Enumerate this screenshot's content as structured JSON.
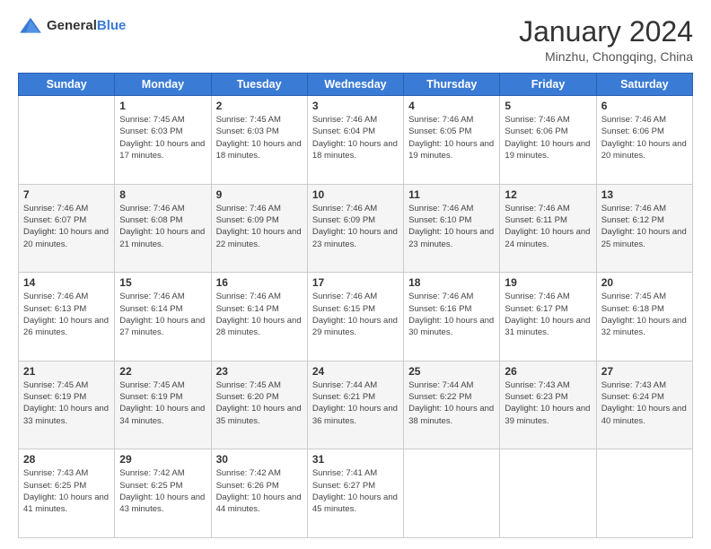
{
  "logo": {
    "general": "General",
    "blue": "Blue"
  },
  "header": {
    "month": "January 2024",
    "location": "Minzhu, Chongqing, China"
  },
  "weekdays": [
    "Sunday",
    "Monday",
    "Tuesday",
    "Wednesday",
    "Thursday",
    "Friday",
    "Saturday"
  ],
  "weeks": [
    [
      {
        "day": "",
        "sunrise": "",
        "sunset": "",
        "daylight": ""
      },
      {
        "day": "1",
        "sunrise": "Sunrise: 7:45 AM",
        "sunset": "Sunset: 6:03 PM",
        "daylight": "Daylight: 10 hours and 17 minutes."
      },
      {
        "day": "2",
        "sunrise": "Sunrise: 7:45 AM",
        "sunset": "Sunset: 6:03 PM",
        "daylight": "Daylight: 10 hours and 18 minutes."
      },
      {
        "day": "3",
        "sunrise": "Sunrise: 7:46 AM",
        "sunset": "Sunset: 6:04 PM",
        "daylight": "Daylight: 10 hours and 18 minutes."
      },
      {
        "day": "4",
        "sunrise": "Sunrise: 7:46 AM",
        "sunset": "Sunset: 6:05 PM",
        "daylight": "Daylight: 10 hours and 19 minutes."
      },
      {
        "day": "5",
        "sunrise": "Sunrise: 7:46 AM",
        "sunset": "Sunset: 6:06 PM",
        "daylight": "Daylight: 10 hours and 19 minutes."
      },
      {
        "day": "6",
        "sunrise": "Sunrise: 7:46 AM",
        "sunset": "Sunset: 6:06 PM",
        "daylight": "Daylight: 10 hours and 20 minutes."
      }
    ],
    [
      {
        "day": "7",
        "sunrise": "Sunrise: 7:46 AM",
        "sunset": "Sunset: 6:07 PM",
        "daylight": "Daylight: 10 hours and 20 minutes."
      },
      {
        "day": "8",
        "sunrise": "Sunrise: 7:46 AM",
        "sunset": "Sunset: 6:08 PM",
        "daylight": "Daylight: 10 hours and 21 minutes."
      },
      {
        "day": "9",
        "sunrise": "Sunrise: 7:46 AM",
        "sunset": "Sunset: 6:09 PM",
        "daylight": "Daylight: 10 hours and 22 minutes."
      },
      {
        "day": "10",
        "sunrise": "Sunrise: 7:46 AM",
        "sunset": "Sunset: 6:09 PM",
        "daylight": "Daylight: 10 hours and 23 minutes."
      },
      {
        "day": "11",
        "sunrise": "Sunrise: 7:46 AM",
        "sunset": "Sunset: 6:10 PM",
        "daylight": "Daylight: 10 hours and 23 minutes."
      },
      {
        "day": "12",
        "sunrise": "Sunrise: 7:46 AM",
        "sunset": "Sunset: 6:11 PM",
        "daylight": "Daylight: 10 hours and 24 minutes."
      },
      {
        "day": "13",
        "sunrise": "Sunrise: 7:46 AM",
        "sunset": "Sunset: 6:12 PM",
        "daylight": "Daylight: 10 hours and 25 minutes."
      }
    ],
    [
      {
        "day": "14",
        "sunrise": "Sunrise: 7:46 AM",
        "sunset": "Sunset: 6:13 PM",
        "daylight": "Daylight: 10 hours and 26 minutes."
      },
      {
        "day": "15",
        "sunrise": "Sunrise: 7:46 AM",
        "sunset": "Sunset: 6:14 PM",
        "daylight": "Daylight: 10 hours and 27 minutes."
      },
      {
        "day": "16",
        "sunrise": "Sunrise: 7:46 AM",
        "sunset": "Sunset: 6:14 PM",
        "daylight": "Daylight: 10 hours and 28 minutes."
      },
      {
        "day": "17",
        "sunrise": "Sunrise: 7:46 AM",
        "sunset": "Sunset: 6:15 PM",
        "daylight": "Daylight: 10 hours and 29 minutes."
      },
      {
        "day": "18",
        "sunrise": "Sunrise: 7:46 AM",
        "sunset": "Sunset: 6:16 PM",
        "daylight": "Daylight: 10 hours and 30 minutes."
      },
      {
        "day": "19",
        "sunrise": "Sunrise: 7:46 AM",
        "sunset": "Sunset: 6:17 PM",
        "daylight": "Daylight: 10 hours and 31 minutes."
      },
      {
        "day": "20",
        "sunrise": "Sunrise: 7:45 AM",
        "sunset": "Sunset: 6:18 PM",
        "daylight": "Daylight: 10 hours and 32 minutes."
      }
    ],
    [
      {
        "day": "21",
        "sunrise": "Sunrise: 7:45 AM",
        "sunset": "Sunset: 6:19 PM",
        "daylight": "Daylight: 10 hours and 33 minutes."
      },
      {
        "day": "22",
        "sunrise": "Sunrise: 7:45 AM",
        "sunset": "Sunset: 6:19 PM",
        "daylight": "Daylight: 10 hours and 34 minutes."
      },
      {
        "day": "23",
        "sunrise": "Sunrise: 7:45 AM",
        "sunset": "Sunset: 6:20 PM",
        "daylight": "Daylight: 10 hours and 35 minutes."
      },
      {
        "day": "24",
        "sunrise": "Sunrise: 7:44 AM",
        "sunset": "Sunset: 6:21 PM",
        "daylight": "Daylight: 10 hours and 36 minutes."
      },
      {
        "day": "25",
        "sunrise": "Sunrise: 7:44 AM",
        "sunset": "Sunset: 6:22 PM",
        "daylight": "Daylight: 10 hours and 38 minutes."
      },
      {
        "day": "26",
        "sunrise": "Sunrise: 7:43 AM",
        "sunset": "Sunset: 6:23 PM",
        "daylight": "Daylight: 10 hours and 39 minutes."
      },
      {
        "day": "27",
        "sunrise": "Sunrise: 7:43 AM",
        "sunset": "Sunset: 6:24 PM",
        "daylight": "Daylight: 10 hours and 40 minutes."
      }
    ],
    [
      {
        "day": "28",
        "sunrise": "Sunrise: 7:43 AM",
        "sunset": "Sunset: 6:25 PM",
        "daylight": "Daylight: 10 hours and 41 minutes."
      },
      {
        "day": "29",
        "sunrise": "Sunrise: 7:42 AM",
        "sunset": "Sunset: 6:25 PM",
        "daylight": "Daylight: 10 hours and 43 minutes."
      },
      {
        "day": "30",
        "sunrise": "Sunrise: 7:42 AM",
        "sunset": "Sunset: 6:26 PM",
        "daylight": "Daylight: 10 hours and 44 minutes."
      },
      {
        "day": "31",
        "sunrise": "Sunrise: 7:41 AM",
        "sunset": "Sunset: 6:27 PM",
        "daylight": "Daylight: 10 hours and 45 minutes."
      },
      {
        "day": "",
        "sunrise": "",
        "sunset": "",
        "daylight": ""
      },
      {
        "day": "",
        "sunrise": "",
        "sunset": "",
        "daylight": ""
      },
      {
        "day": "",
        "sunrise": "",
        "sunset": "",
        "daylight": ""
      }
    ]
  ]
}
